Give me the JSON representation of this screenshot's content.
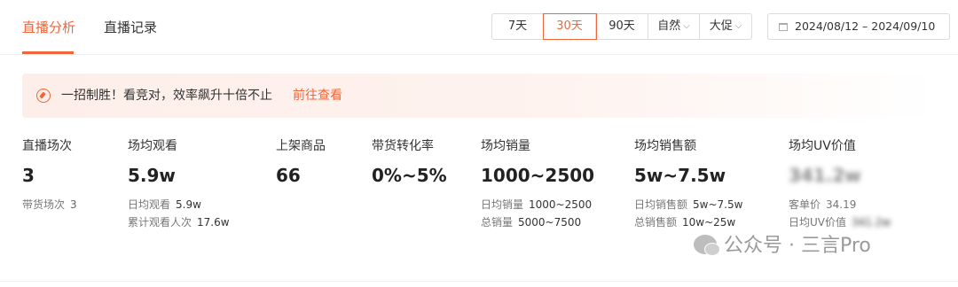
{
  "tabs": [
    {
      "label": "直播分析",
      "active": true
    },
    {
      "label": "直播记录",
      "active": false
    }
  ],
  "range_buttons": [
    {
      "label": "7天",
      "active": false
    },
    {
      "label": "30天",
      "active": true
    },
    {
      "label": "90天",
      "active": false
    }
  ],
  "selects": [
    {
      "label": "自然"
    },
    {
      "label": "大促"
    }
  ],
  "date_range": {
    "text": "2024/08/12 – 2024/09/10"
  },
  "banner": {
    "text": "一招制胜！看竞对，效率飙升十倍不止",
    "link": "前往查看"
  },
  "metrics": [
    {
      "label": "直播场次",
      "value": "3",
      "subs": [
        {
          "label": "带货场次",
          "value": "3"
        }
      ]
    },
    {
      "label": "场均观看",
      "value": "5.9w",
      "subs": [
        {
          "label": "日均观看",
          "value": "5.9w"
        },
        {
          "label": "累计观看人次",
          "value": "17.6w"
        }
      ]
    },
    {
      "label": "上架商品",
      "value": "66",
      "subs": []
    },
    {
      "label": "带货转化率",
      "value": "0%~5%",
      "subs": []
    },
    {
      "label": "场均销量",
      "value": "1000~2500",
      "subs": [
        {
          "label": "日均销量",
          "value": "1000~2500"
        },
        {
          "label": "总销量",
          "value": "5000~7500"
        }
      ]
    },
    {
      "label": "场均销售额",
      "value": "5w~7.5w",
      "subs": [
        {
          "label": "日均销售额",
          "value": "5w~7.5w"
        },
        {
          "label": "总销售额",
          "value": "10w~25w"
        }
      ]
    },
    {
      "label": "场均UV价值",
      "value": "341.2w",
      "subs": [
        {
          "label": "客单价",
          "value": "34.19"
        },
        {
          "label": "日均UV价值",
          "value": "341.2w"
        }
      ]
    }
  ],
  "watermark": {
    "text": "公众号 · 三言Pro"
  },
  "colors": {
    "accent": "#f0663a",
    "banner_bg": "#fdeee9"
  }
}
